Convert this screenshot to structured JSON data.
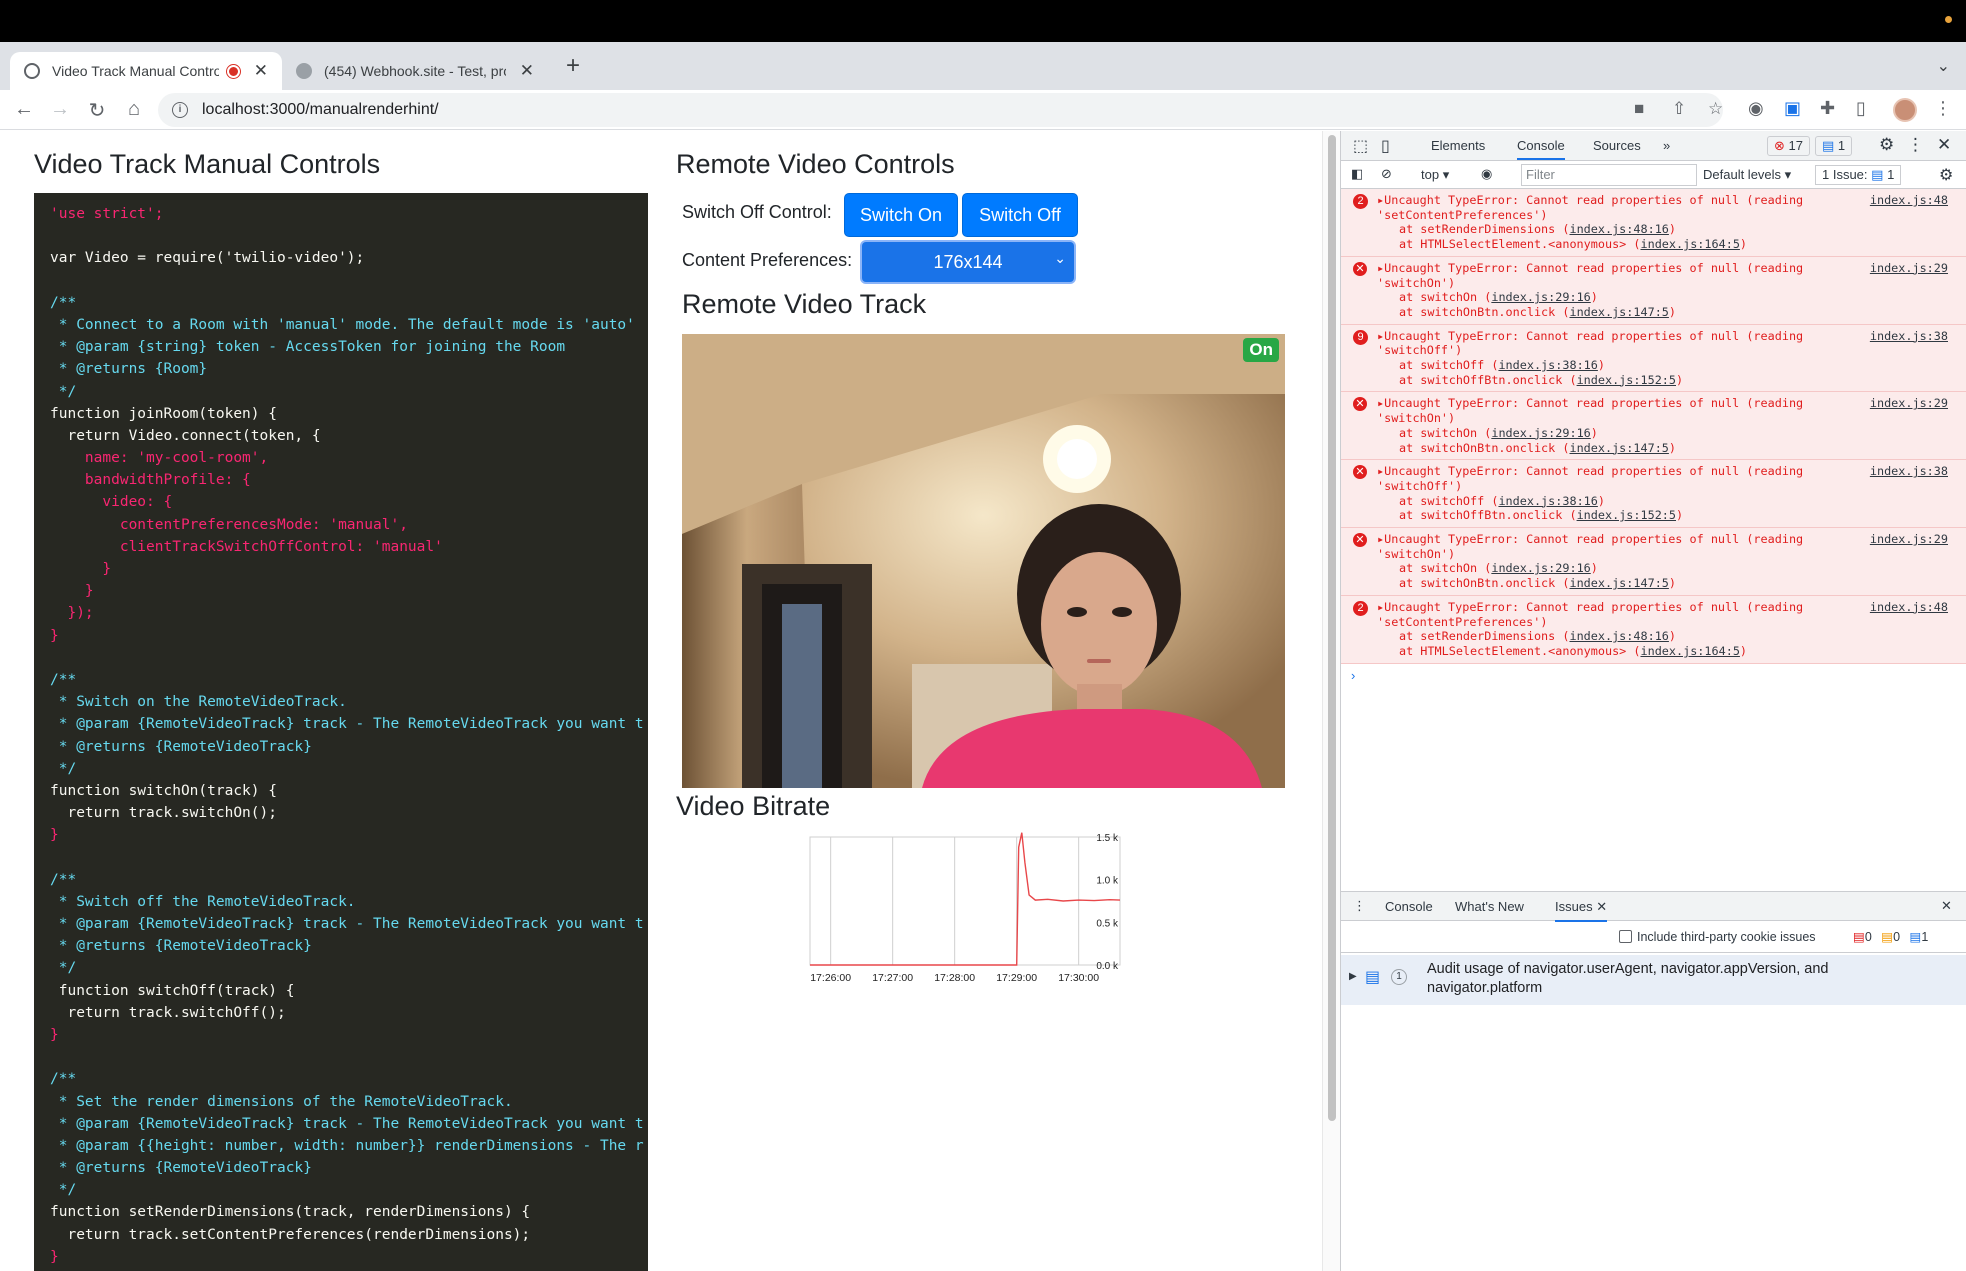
{
  "browser": {
    "tabs": [
      {
        "title": "Video Track Manual Contro",
        "active": true,
        "recording": true
      },
      {
        "title": "(454) Webhook.site - Test, pro",
        "active": false
      }
    ],
    "new_tab": "+",
    "url": "localhost:3000/manualrenderhint/"
  },
  "page": {
    "left_title": "Video Track Manual Controls",
    "right_title": "Remote Video Controls",
    "switch_label": "Switch Off Control:",
    "switch_on": "Switch On",
    "switch_off": "Switch Off",
    "content_label": "Content Preferences:",
    "content_value": "176x144",
    "track_title": "Remote Video Track",
    "status_badge": "On",
    "bitrate_title": "Video Bitrate"
  },
  "code_lines": [
    {
      "t": "'use strict';",
      "c": "kw"
    },
    {
      "t": "",
      "c": "pl"
    },
    {
      "t": "var Video = require('twilio-video');",
      "c": "pl"
    },
    {
      "t": "",
      "c": "pl"
    },
    {
      "t": "/**",
      "c": "cm"
    },
    {
      "t": " * Connect to a Room with 'manual' mode. The default mode is 'auto'",
      "c": "cm"
    },
    {
      "t": " * @param {string} token - AccessToken for joining the Room",
      "c": "cm"
    },
    {
      "t": " * @returns {Room}",
      "c": "cm"
    },
    {
      "t": " */",
      "c": "cm"
    },
    {
      "t": "function joinRoom(token) {",
      "c": "pl"
    },
    {
      "t": "  return Video.connect(token, {",
      "c": "pl"
    },
    {
      "t": "    name: 'my-cool-room',",
      "c": "kw"
    },
    {
      "t": "    bandwidthProfile: {",
      "c": "kw"
    },
    {
      "t": "      video: {",
      "c": "kw"
    },
    {
      "t": "        contentPreferencesMode: 'manual',",
      "c": "kw"
    },
    {
      "t": "        clientTrackSwitchOffControl: 'manual'",
      "c": "kw"
    },
    {
      "t": "      }",
      "c": "kw"
    },
    {
      "t": "    }",
      "c": "kw"
    },
    {
      "t": "  });",
      "c": "kw"
    },
    {
      "t": "}",
      "c": "kw"
    },
    {
      "t": "",
      "c": "pl"
    },
    {
      "t": "/**",
      "c": "cm"
    },
    {
      "t": " * Switch on the RemoteVideoTrack.",
      "c": "cm"
    },
    {
      "t": " * @param {RemoteVideoTrack} track - The RemoteVideoTrack you want t",
      "c": "cm"
    },
    {
      "t": " * @returns {RemoteVideoTrack}",
      "c": "cm"
    },
    {
      "t": " */",
      "c": "cm"
    },
    {
      "t": "function switchOn(track) {",
      "c": "pl"
    },
    {
      "t": "  return track.switchOn();",
      "c": "pl"
    },
    {
      "t": "}",
      "c": "kw"
    },
    {
      "t": "",
      "c": "pl"
    },
    {
      "t": "/**",
      "c": "cm"
    },
    {
      "t": " * Switch off the RemoteVideoTrack.",
      "c": "cm"
    },
    {
      "t": " * @param {RemoteVideoTrack} track - The RemoteVideoTrack you want t",
      "c": "cm"
    },
    {
      "t": " * @returns {RemoteVideoTrack}",
      "c": "cm"
    },
    {
      "t": " */",
      "c": "cm"
    },
    {
      "t": " function switchOff(track) {",
      "c": "pl"
    },
    {
      "t": "  return track.switchOff();",
      "c": "pl"
    },
    {
      "t": "}",
      "c": "kw"
    },
    {
      "t": "",
      "c": "pl"
    },
    {
      "t": "/**",
      "c": "cm"
    },
    {
      "t": " * Set the render dimensions of the RemoteVideoTrack.",
      "c": "cm"
    },
    {
      "t": " * @param {RemoteVideoTrack} track - The RemoteVideoTrack you want t",
      "c": "cm"
    },
    {
      "t": " * @param {{height: number, width: number}} renderDimensions - The r",
      "c": "cm"
    },
    {
      "t": " * @returns {RemoteVideoTrack}",
      "c": "cm"
    },
    {
      "t": " */",
      "c": "cm"
    },
    {
      "t": "function setRenderDimensions(track, renderDimensions) {",
      "c": "pl"
    },
    {
      "t": "  return track.setContentPreferences(renderDimensions);",
      "c": "pl"
    },
    {
      "t": "}",
      "c": "kw"
    }
  ],
  "chart_data": {
    "type": "line",
    "title": "",
    "xlabel": "",
    "ylabel": "",
    "x_ticks": [
      "17:26:00",
      "17:27:00",
      "17:28:00",
      "17:29:00",
      "17:30:00"
    ],
    "y_ticks": [
      "1.5 k",
      "1.0 k",
      "0.5 k",
      "0.0 k"
    ],
    "ylim": [
      0,
      1500
    ],
    "grid": true,
    "series": [
      {
        "color": "#e8474a",
        "points": [
          [
            "17:25:40",
            0
          ],
          [
            "17:26:00",
            0
          ],
          [
            "17:27:00",
            0
          ],
          [
            "17:28:00",
            0
          ],
          [
            "17:29:00",
            0
          ],
          [
            "17:29:02",
            1380
          ],
          [
            "17:29:05",
            1550
          ],
          [
            "17:29:08",
            1200
          ],
          [
            "17:29:12",
            820
          ],
          [
            "17:29:18",
            760
          ],
          [
            "17:29:30",
            770
          ],
          [
            "17:29:45",
            750
          ],
          [
            "17:30:00",
            760
          ],
          [
            "17:30:15",
            755
          ],
          [
            "17:30:30",
            765
          ],
          [
            "17:30:40",
            760
          ]
        ]
      }
    ]
  },
  "devtools": {
    "tabs": [
      "Elements",
      "Console",
      "Sources"
    ],
    "error_count": "17",
    "info_count": "1",
    "context": "top",
    "filter_placeholder": "Filter",
    "levels": "Default levels",
    "issues_badge": "1 Issue:",
    "issues_count": "1",
    "errors": [
      {
        "count": "2",
        "msg": "Uncaught TypeError: Cannot read properties of null (reading",
        "arg": "'setContentPreferences')",
        "src": "index.js:48",
        "stack": [
          [
            "at setRenderDimensions (",
            "index.js:48:16",
            ")"
          ],
          [
            "at HTMLSelectElement.<anonymous> (",
            "index.js:164:5",
            ")"
          ]
        ]
      },
      {
        "count": "",
        "msg": "Uncaught TypeError: Cannot read properties of null (reading",
        "arg": "'switchOn')",
        "src": "index.js:29",
        "stack": [
          [
            "at switchOn (",
            "index.js:29:16",
            ")"
          ],
          [
            "at switchOnBtn.onclick (",
            "index.js:147:5",
            ")"
          ]
        ]
      },
      {
        "count": "9",
        "msg": "Uncaught TypeError: Cannot read properties of null (reading",
        "arg": "'switchOff')",
        "src": "index.js:38",
        "stack": [
          [
            "at switchOff (",
            "index.js:38:16",
            ")"
          ],
          [
            "at switchOffBtn.onclick (",
            "index.js:152:5",
            ")"
          ]
        ]
      },
      {
        "count": "",
        "msg": "Uncaught TypeError: Cannot read properties of null (reading",
        "arg": "'switchOn')",
        "src": "index.js:29",
        "stack": [
          [
            "at switchOn (",
            "index.js:29:16",
            ")"
          ],
          [
            "at switchOnBtn.onclick (",
            "index.js:147:5",
            ")"
          ]
        ]
      },
      {
        "count": "",
        "msg": "Uncaught TypeError: Cannot read properties of null (reading",
        "arg": "'switchOff')",
        "src": "index.js:38",
        "stack": [
          [
            "at switchOff (",
            "index.js:38:16",
            ")"
          ],
          [
            "at switchOffBtn.onclick (",
            "index.js:152:5",
            ")"
          ]
        ]
      },
      {
        "count": "",
        "msg": "Uncaught TypeError: Cannot read properties of null (reading",
        "arg": "'switchOn')",
        "src": "index.js:29",
        "stack": [
          [
            "at switchOn (",
            "index.js:29:16",
            ")"
          ],
          [
            "at switchOnBtn.onclick (",
            "index.js:147:5",
            ")"
          ]
        ]
      },
      {
        "count": "2",
        "msg": "Uncaught TypeError: Cannot read properties of null (reading",
        "arg": "'setContentPreferences')",
        "src": "index.js:48",
        "stack": [
          [
            "at setRenderDimensions (",
            "index.js:48:16",
            ")"
          ],
          [
            "at HTMLSelectElement.<anonymous> (",
            "index.js:164:5",
            ")"
          ]
        ]
      }
    ],
    "drawer_tabs": [
      "Console",
      "What's New",
      "Issues"
    ],
    "third_party_label": "Include third-party cookie issues",
    "issue_counts": [
      "0",
      "0",
      "1"
    ],
    "issue_text_1": "Audit usage of navigator.userAgent, navigator.appVersion, and",
    "issue_text_2": "navigator.platform",
    "issue_num": "1"
  }
}
